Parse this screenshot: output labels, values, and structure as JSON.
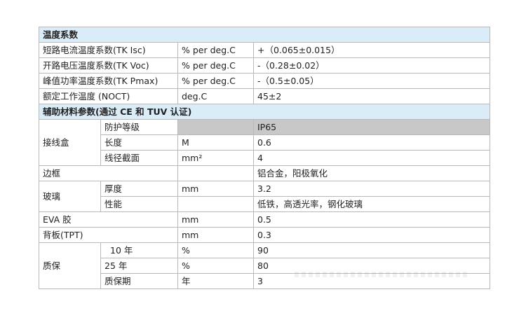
{
  "sections": {
    "temperature_title": "温度系数",
    "auxiliary_title": "辅助材料参数(通过 CE 和 TUV 认证)"
  },
  "temp_rows": [
    {
      "label": "短路电流温度系数(TK Isc)",
      "unit": "% per deg.C",
      "value": "+（0.065±0.015）"
    },
    {
      "label": "开路电压温度系数(TK Voc)",
      "unit": "% per deg.C",
      "value": "-（0.28±0.02）"
    },
    {
      "label": "峰值功率温度系数(TK Pmax)",
      "unit": "% per deg.C",
      "value": "-（0.5±0.05）"
    },
    {
      "label": "额定工作温度 (NOCT)",
      "unit": "deg.C",
      "value": "45±2"
    }
  ],
  "junction_box": {
    "label": "接线盒",
    "rows": [
      {
        "sub": "防护等级",
        "unit": "",
        "value": "IP65"
      },
      {
        "sub": "长度",
        "unit": "M",
        "value": "0.6"
      },
      {
        "sub": "线径截面",
        "unit": "mm²",
        "value": "4"
      }
    ]
  },
  "frame": {
    "label": "边框",
    "unit": "",
    "value": "铝合金，阳极氧化"
  },
  "glass": {
    "label": "玻璃",
    "rows": [
      {
        "sub": "厚度",
        "unit": "mm",
        "value": "3.2"
      },
      {
        "sub": "性能",
        "unit": "",
        "value": "低铁，高透光率，钢化玻璃"
      }
    ]
  },
  "eva": {
    "label": "EVA 胶",
    "unit": "mm",
    "value": "0.5"
  },
  "backsheet": {
    "label": "背板(TPT)",
    "unit": "mm",
    "value": "0.3"
  },
  "warranty": {
    "label": "质保",
    "rows": [
      {
        "sub": "10 年",
        "unit": "%",
        "value": "90"
      },
      {
        "sub": "25 年",
        "unit": "%",
        "value": "80"
      },
      {
        "sub": "质保期",
        "unit": "年",
        "value": "3"
      }
    ]
  }
}
